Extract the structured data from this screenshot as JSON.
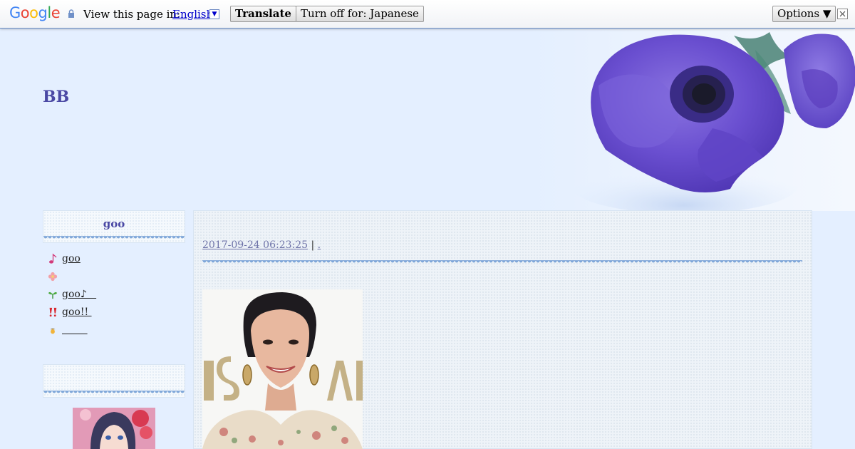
{
  "translate_bar": {
    "logo": "Google",
    "view_label": "View this page in:",
    "language": "English",
    "dropdown_glyph": "▼",
    "translate_label": "Translate",
    "turn_off_label": "Turn off for: Japanese",
    "options_label": "Options ▼"
  },
  "header": {
    "site_title": "BB"
  },
  "sidebar": {
    "box1_title": "goo",
    "items": [
      {
        "label": "goo",
        "icon": "music-note-icon"
      },
      {
        "label": "",
        "icon": "flower-icon"
      },
      {
        "label": "goo♪   ",
        "icon": "sprout-icon"
      },
      {
        "label": "goo!! ",
        "icon": "exclamation-icon"
      },
      {
        "label": "        ",
        "icon": "acorn-icon"
      }
    ],
    "box2_title": ""
  },
  "entry": {
    "date": "2017-09-24 06:23:25",
    "separator": "|",
    "category": "."
  },
  "colors": {
    "background": "#e4efff",
    "title": "#4a48a4",
    "link_meta": "#6f74a9",
    "lace": "#7fa7d9"
  }
}
